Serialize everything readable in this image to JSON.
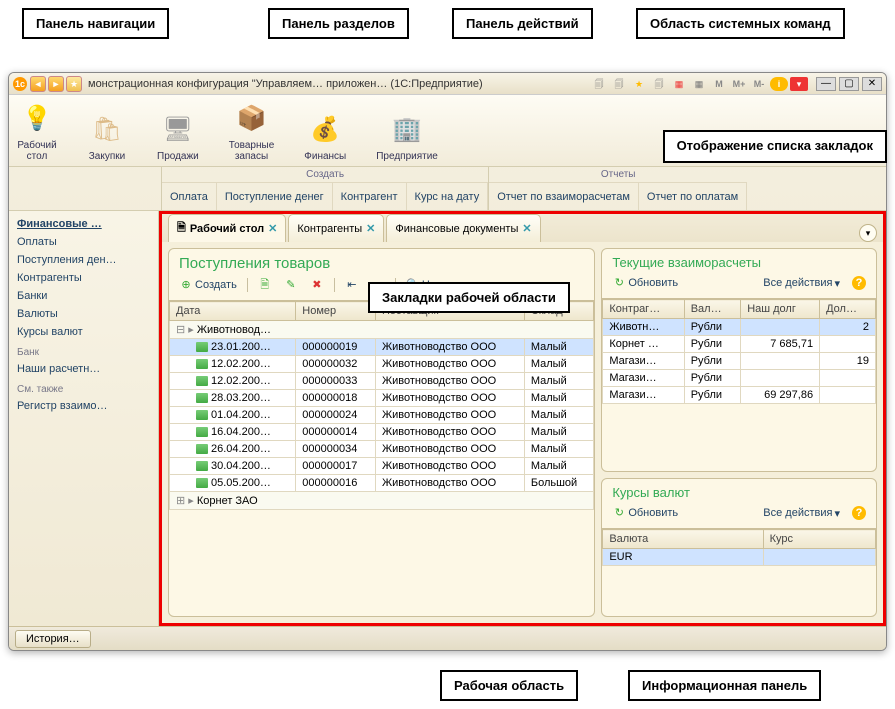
{
  "callouts": {
    "nav": "Панель навигации",
    "sections": "Панель разделов",
    "actions": "Панель действий",
    "syscommands": "Область системных команд",
    "tablist": "Отображение списка закладок",
    "tabsarea": "Закладки рабочей области",
    "workspace": "Рабочая область",
    "infopanel": "Информационная панель"
  },
  "title": "монстрационная конфигурация \"Управляем… приложен… (1С:Предприятие)",
  "sections": [
    {
      "label": "Рабочий стол",
      "icon": "💡",
      "color": "#7bd"
    },
    {
      "label": "Закупки",
      "icon": "🛍",
      "color": "#db8"
    },
    {
      "label": "Продажи",
      "icon": "🖥",
      "color": "#999"
    },
    {
      "label": "Товарные запасы",
      "icon": "📦",
      "color": "#c96"
    },
    {
      "label": "Финансы",
      "icon": "💰",
      "color": "#dc5"
    },
    {
      "label": "Предприятие",
      "icon": "🏢",
      "color": "#59c"
    }
  ],
  "action_groups": [
    {
      "title": "Создать",
      "items": [
        "Оплата",
        "Поступление денег",
        "Контрагент",
        "Курс на дату"
      ]
    },
    {
      "title": "Отчеты",
      "items": [
        "Отчет по взаиморасчетам",
        "Отчет по оплатам"
      ]
    }
  ],
  "nav": {
    "active": "Финансовые …",
    "items": [
      "Оплаты",
      "Поступления ден…",
      "Контрагенты",
      "Банки",
      "Валюты",
      "Курсы валют"
    ],
    "section2_title": "Банк",
    "section2_items": [
      "Наши расчетн…"
    ],
    "section3_title": "См. также",
    "section3_items": [
      "Регистр взаимо…"
    ]
  },
  "tabs": [
    {
      "label": "Рабочий стол",
      "active": true
    },
    {
      "label": "Контрагенты",
      "active": false
    },
    {
      "label": "Финансовые документы",
      "active": false
    }
  ],
  "left_panel": {
    "title": "Поступления товаров",
    "create_label": "Создать",
    "find_label": "Н",
    "columns": [
      "Дата",
      "Номер",
      "Поставщик",
      "Склад"
    ],
    "group_row": "Животновод…",
    "rows": [
      {
        "date": "23.01.200…",
        "num": "000000019",
        "sup": "Животноводство ООО",
        "wh": "Малый",
        "sel": true
      },
      {
        "date": "12.02.200…",
        "num": "000000032",
        "sup": "Животноводство ООО",
        "wh": "Малый"
      },
      {
        "date": "12.02.200…",
        "num": "000000033",
        "sup": "Животноводство ООО",
        "wh": "Малый"
      },
      {
        "date": "28.03.200…",
        "num": "000000018",
        "sup": "Животноводство ООО",
        "wh": "Малый"
      },
      {
        "date": "01.04.200…",
        "num": "000000024",
        "sup": "Животноводство ООО",
        "wh": "Малый"
      },
      {
        "date": "16.04.200…",
        "num": "000000014",
        "sup": "Животноводство ООО",
        "wh": "Малый"
      },
      {
        "date": "26.04.200…",
        "num": "000000034",
        "sup": "Животноводство ООО",
        "wh": "Малый"
      },
      {
        "date": "30.04.200…",
        "num": "000000017",
        "sup": "Животноводство ООО",
        "wh": "Малый"
      },
      {
        "date": "05.05.200…",
        "num": "000000016",
        "sup": "Животноводство ООО",
        "wh": "Большой"
      }
    ],
    "footer_row": "Корнет ЗАО"
  },
  "right_panel1": {
    "title": "Текущие взаиморасчеты",
    "refresh": "Обновить",
    "actions": "Все действия",
    "columns": [
      "Контраг…",
      "Вал…",
      "Наш долг",
      "Дол…"
    ],
    "rows": [
      {
        "c": "Животн…",
        "v": "Рубли",
        "d": "",
        "d2": "2",
        "sel": true
      },
      {
        "c": "Корнет …",
        "v": "Рубли",
        "d": "7 685,71",
        "d2": ""
      },
      {
        "c": "Магази…",
        "v": "Рубли",
        "d": "",
        "d2": "19"
      },
      {
        "c": "Магази…",
        "v": "Рубли",
        "d": "",
        "d2": ""
      },
      {
        "c": "Магази…",
        "v": "Рубли",
        "d": "69 297,86",
        "d2": ""
      }
    ]
  },
  "right_panel2": {
    "title": "Курсы валют",
    "refresh": "Обновить",
    "actions": "Все действия",
    "columns": [
      "Валюта",
      "Курс"
    ],
    "rows": [
      {
        "c": "EUR",
        "k": ""
      }
    ]
  },
  "status": {
    "history": "История…"
  },
  "sysbar": [
    "M",
    "M+",
    "M-"
  ]
}
